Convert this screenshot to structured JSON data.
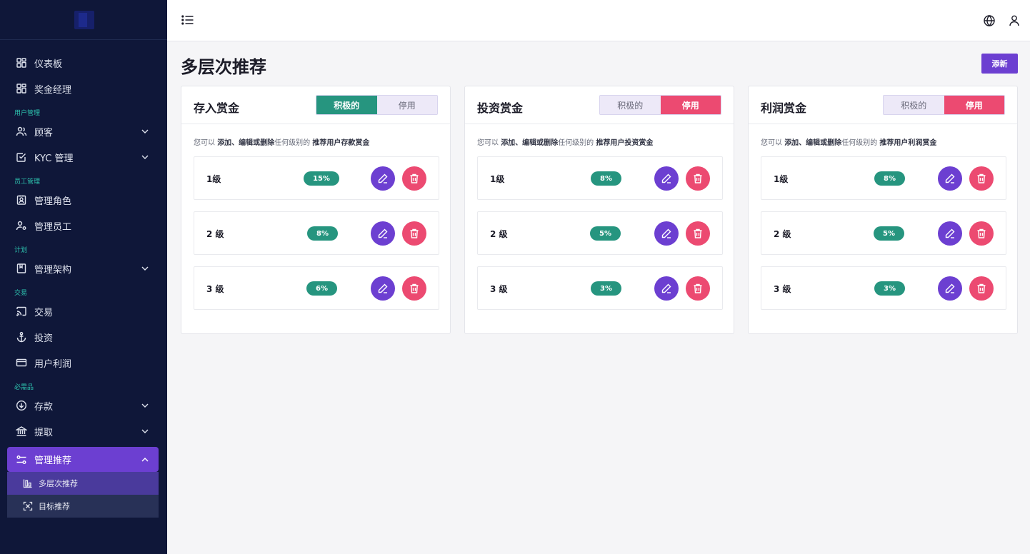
{
  "sidebar": {
    "items": [
      {
        "label": "仪表板",
        "icon": "dashboard-icon"
      },
      {
        "label": "奖金经理",
        "icon": "dashboard-icon"
      }
    ],
    "sections": {
      "users": "用户管理",
      "staff": "员工管理",
      "plans": "计划",
      "trade": "交易",
      "essentials": "必需品"
    },
    "customers": "顾客",
    "kyc": "KYC 管理",
    "manage_roles": "管理角色",
    "manage_staff": "管理员工",
    "manage_schema": "管理架构",
    "transactions": "交易",
    "investments": "投资",
    "user_profit": "用户利润",
    "deposit": "存款",
    "withdraw": "提取",
    "manage_referral": "管理推荐",
    "sub_multilevel": "多层次推荐",
    "sub_target": "目标推荐"
  },
  "page": {
    "title": "多层次推荐",
    "add_label": "添新"
  },
  "toggle": {
    "active": "积极的",
    "disabled": "停用"
  },
  "cards": [
    {
      "title": "存入赏金",
      "status": "active",
      "desc_prefix": "您可以",
      "desc_actions": "添加、编辑或删除",
      "desc_middle": "任何级别的",
      "desc_target": "推荐用户存款赏金",
      "levels": [
        {
          "name": "1级",
          "percent": "15%"
        },
        {
          "name": "2 级",
          "percent": "8%"
        },
        {
          "name": "3 级",
          "percent": "6%"
        }
      ]
    },
    {
      "title": "投资赏金",
      "status": "disabled",
      "desc_prefix": "您可以",
      "desc_actions": "添加、编辑或删除",
      "desc_middle": "任何级别的",
      "desc_target": "推荐用户投资赏金",
      "levels": [
        {
          "name": "1级",
          "percent": "8%"
        },
        {
          "name": "2 级",
          "percent": "5%"
        },
        {
          "name": "3 级",
          "percent": "3%"
        }
      ]
    },
    {
      "title": "利润赏金",
      "status": "disabled",
      "desc_prefix": "您可以",
      "desc_actions": "添加、编辑或删除",
      "desc_middle": "任何级别的",
      "desc_target": "推荐用户利润赏金",
      "levels": [
        {
          "name": "1级",
          "percent": "8%"
        },
        {
          "name": "2 级",
          "percent": "5%"
        },
        {
          "name": "3 级",
          "percent": "3%"
        }
      ]
    }
  ],
  "colors": {
    "sidebar_bg": "#0f1739",
    "primary": "#6c3fd1",
    "success": "#26957f",
    "danger": "#ec4a71",
    "section_title": "#2ec4b0"
  }
}
